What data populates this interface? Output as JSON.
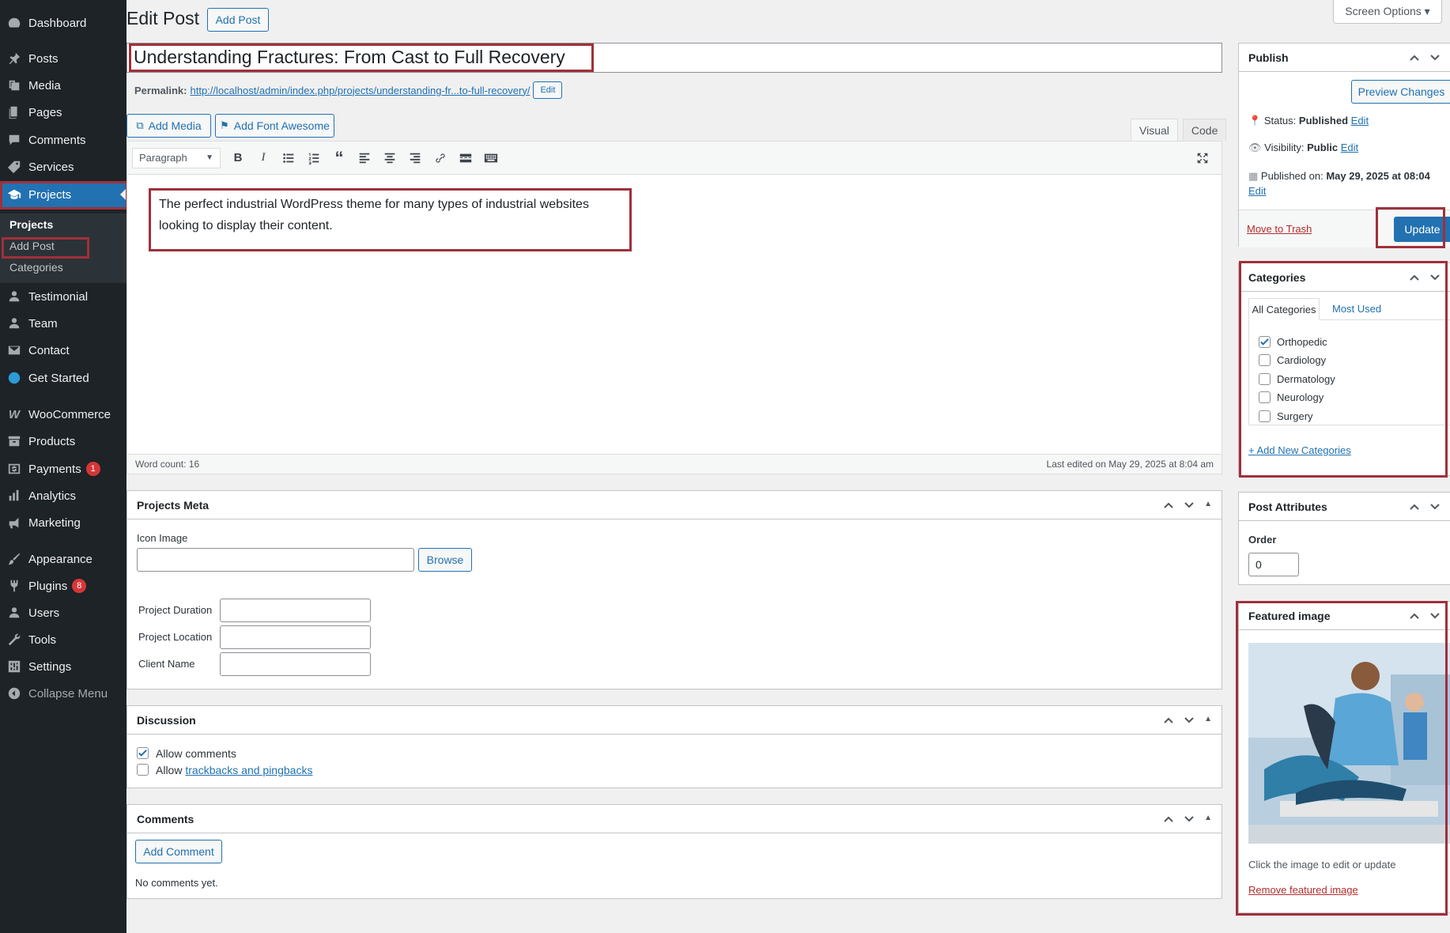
{
  "sidebar": {
    "items": [
      {
        "label": "Dashboard",
        "icon": "dashboard-icon"
      },
      {
        "label": "Posts",
        "icon": "pin-icon"
      },
      {
        "label": "Media",
        "icon": "media-icon"
      },
      {
        "label": "Pages",
        "icon": "page-icon"
      },
      {
        "label": "Comments",
        "icon": "comment-icon"
      },
      {
        "label": "Services",
        "icon": "tag-icon"
      },
      {
        "label": "Projects",
        "icon": "graduation-cap-icon"
      },
      {
        "label": "Testimonial",
        "icon": "user-icon"
      },
      {
        "label": "Team",
        "icon": "user-icon"
      },
      {
        "label": "Contact",
        "icon": "envelope-icon"
      },
      {
        "label": "Get Started",
        "icon": "globe-icon"
      },
      {
        "label": "WooCommerce",
        "icon": "woo-icon"
      },
      {
        "label": "Products",
        "icon": "archive-icon"
      },
      {
        "label": "Payments",
        "icon": "dollar-icon",
        "badge": "1"
      },
      {
        "label": "Analytics",
        "icon": "bar-chart-icon"
      },
      {
        "label": "Marketing",
        "icon": "megaphone-icon"
      },
      {
        "label": "Appearance",
        "icon": "brush-icon"
      },
      {
        "label": "Plugins",
        "icon": "plug-icon",
        "badge": "8"
      },
      {
        "label": "Users",
        "icon": "user-icon"
      },
      {
        "label": "Tools",
        "icon": "wrench-icon"
      },
      {
        "label": "Settings",
        "icon": "settings-icon"
      },
      {
        "label": "Collapse Menu",
        "icon": "collapse-icon"
      }
    ],
    "submenu": [
      "Projects",
      "Add Post",
      "Categories"
    ]
  },
  "header": {
    "title": "Edit Post",
    "add_post": "Add Post",
    "screen_options": "Screen Options ▾"
  },
  "post": {
    "title": "Understanding Fractures: From Cast to Full Recovery",
    "permalink_label": "Permalink:",
    "permalink_url": "http://localhost/admin/index.php/projects/understanding-fr...to-full-recovery/",
    "permalink_edit": "Edit",
    "add_media": "Add Media",
    "add_font_awesome": "Add Font Awesome",
    "tab_visual": "Visual",
    "tab_code": "Code",
    "format_select": "Paragraph",
    "content": "The perfect industrial WordPress theme for many types of industrial websites looking to display their content.",
    "word_count": "Word count: 16",
    "last_edited": "Last edited on May 29, 2025 at 8:04 am"
  },
  "projects_meta": {
    "title": "Projects Meta",
    "icon_image_label": "Icon Image",
    "browse": "Browse",
    "duration_label": "Project Duration",
    "location_label": "Project Location",
    "client_label": "Client Name"
  },
  "discussion": {
    "title": "Discussion",
    "allow_comments": "Allow comments",
    "allow_prefix": "Allow",
    "trackbacks_link": "trackbacks and pingbacks"
  },
  "comments": {
    "title": "Comments",
    "add_comment": "Add Comment",
    "empty": "No comments yet."
  },
  "publish": {
    "title": "Publish",
    "preview": "Preview Changes",
    "status_label": "Status:",
    "status_value": "Published",
    "visibility_label": "Visibility:",
    "visibility_value": "Public",
    "published_label": "Published on:",
    "published_value": "May 29, 2025 at 08:04",
    "edit": "Edit",
    "trash": "Move to Trash",
    "update": "Update"
  },
  "categories": {
    "title": "Categories",
    "tab_all": "All Categories",
    "tab_most_used": "Most Used",
    "items": [
      {
        "label": "Orthopedic",
        "checked": true
      },
      {
        "label": "Cardiology",
        "checked": false
      },
      {
        "label": "Dermatology",
        "checked": false
      },
      {
        "label": "Neurology",
        "checked": false
      },
      {
        "label": "Surgery",
        "checked": false
      }
    ],
    "add_new": "+ Add New Categories"
  },
  "attributes": {
    "title": "Post Attributes",
    "order_label": "Order",
    "order_value": "0"
  },
  "featured": {
    "title": "Featured image",
    "hint": "Click the image to edit or update",
    "remove": "Remove featured image"
  },
  "colors": {
    "accent": "#2271b1",
    "sidebar_bg": "#1d2327",
    "highlight": "#a0303a"
  }
}
